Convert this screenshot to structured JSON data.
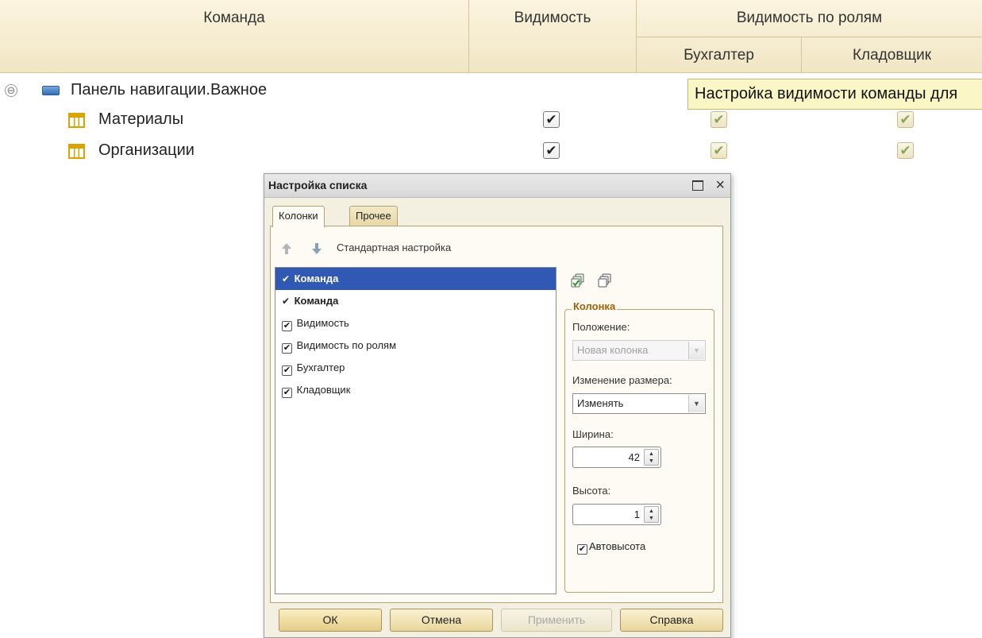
{
  "table": {
    "columns": {
      "command": "Команда",
      "visibility": "Видимость",
      "visibility_by_roles": "Видимость по ролям",
      "role_accountant": "Бухгалтер",
      "role_storekeeper": "Кладовщик"
    },
    "rows": [
      {
        "label": "Панель навигации.Важное",
        "expander": "⊖"
      },
      {
        "label": "Материалы",
        "visible_check": "✔",
        "accountant_check": "✔",
        "storekeeper_check": "✔"
      },
      {
        "label": "Организации",
        "visible_check": "✔",
        "accountant_check": "✔",
        "storekeeper_check": "✔"
      }
    ],
    "tooltip": "Настройка видимости команды для"
  },
  "dialog": {
    "title": "Настройка списка",
    "maximize_glyph": "",
    "close_glyph": "×",
    "tabs": [
      {
        "label": "Колонки",
        "active": true
      },
      {
        "label": "Прочее",
        "active": false
      }
    ],
    "standard_settings": "Стандартная настройка",
    "columns_list": [
      {
        "label": "Команда",
        "mark": "✔",
        "selected": true,
        "bold": true
      },
      {
        "label": "Команда",
        "mark": "✔",
        "selected": false,
        "bold": true
      },
      {
        "label": "Видимость",
        "mark": "✔",
        "checkbox": true
      },
      {
        "label": "Видимость по ролям",
        "mark": "✔",
        "checkbox": true
      },
      {
        "label": "Бухгалтер",
        "mark": "✔",
        "checkbox": true
      },
      {
        "label": "Кладовщик",
        "mark": "✔",
        "checkbox": true
      }
    ],
    "column_group": {
      "legend": "Колонка",
      "position_label": "Положение:",
      "position_value": "Новая колонка",
      "resize_label": "Изменение размера:",
      "resize_value": "Изменять",
      "width_label": "Ширина:",
      "width_value": "42",
      "height_label": "Высота:",
      "height_value": "1",
      "auto_height_label": "Автовысота",
      "auto_height_mark": "✔"
    },
    "buttons": {
      "ok": "ОК",
      "cancel": "Отмена",
      "apply": "Применить",
      "help": "Справка"
    }
  },
  "colors": {
    "header_bg": "#f1e6c4",
    "selection": "#2f59b2",
    "group_legend": "#a0620b",
    "tooltip_bg": "#fbf6c6"
  },
  "icons": [
    "panel-icon",
    "table-icon",
    "arrow-up-icon",
    "arrow-down-icon",
    "check-all-icon",
    "uncheck-all-icon",
    "maximize-icon",
    "close-icon",
    "dropdown-arrow-icon",
    "spinner-icon"
  ]
}
